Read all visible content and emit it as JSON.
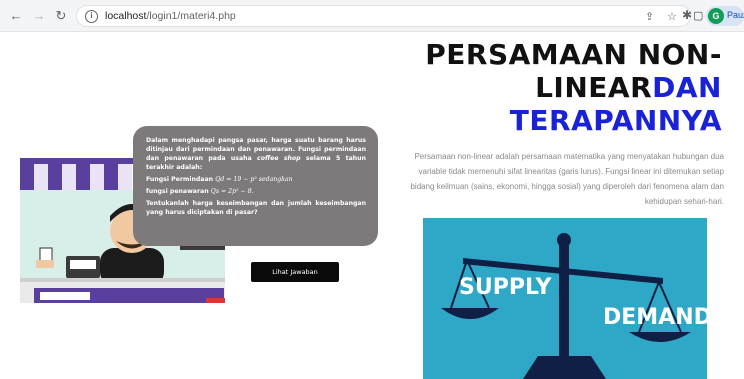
{
  "browser": {
    "url_host": "localhost",
    "url_path": "/login1/materi4.php",
    "profile_initial": "G",
    "profile_name": "Pauze"
  },
  "hero": {
    "title_line1": "PERSAMAAN NON-",
    "title_line2_dark": "LINEAR",
    "title_line2_accent": "DAN",
    "title_line3_accent": "TERAPANNYA",
    "description": "Persamaan non-linear adalah persamaan matematika yang menyatakan hubungan dua variable tidak memenuhi sifat linearitas (garis lurus). Fungsi linear ini ditemukan setiap bidang keilmuan (sains, ekonomi, hingga sosial) yang diperoleh dari fenomena alam dan kehidupan sehari-hari."
  },
  "problem": {
    "p1_a": "Dalam menghadapi pangsa pasar, harga suatu barang harus ditinjau dari permindaan dan penawaran. Fungsi permindaan dan penawaran pada usaha ",
    "p1_italic": "coffee shop",
    "p1_b": " selama 5 tahun terakhir adalah:",
    "p2_a": "Fungsi Permindaan ",
    "p2_math": "Qd = 19 − p² sedangkan",
    "p3_a": "fungsi penawaran ",
    "p3_math": "Qs = 2p² − 8.",
    "p4": "Tentukanlah harga keseimbangan dan jumlah keseimbangan yang harus diciptakan di pasar?"
  },
  "answer_button": "Lihat Jawaban",
  "image_text": {
    "supply": "SUPPLY",
    "demand": "DEMAND"
  },
  "colors": {
    "accent": "#1a22d8",
    "bubble": "#7e7a7c",
    "image_bg": "#2ea8c6"
  }
}
